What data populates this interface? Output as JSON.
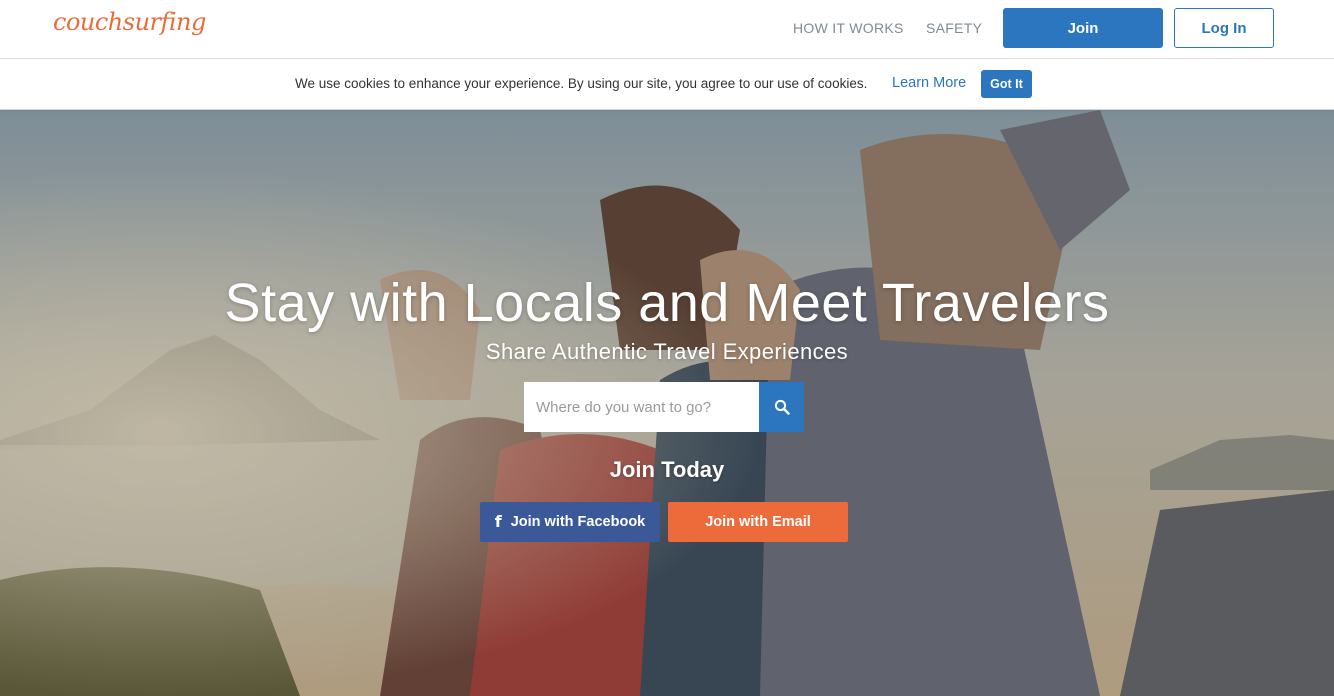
{
  "header": {
    "logo_text": "couchsurfing",
    "nav": {
      "how_it_works": "HOW IT WORKS",
      "safety": "SAFETY"
    },
    "join_label": "Join",
    "login_label": "Log In"
  },
  "cookie_banner": {
    "message": "We use cookies to enhance your experience. By using our site, you agree to our use of cookies.",
    "learn_more": "Learn More",
    "got_it": "Got It"
  },
  "hero": {
    "title": "Stay with Locals and Meet Travelers",
    "subtitle": "Share Authentic Travel Experiences",
    "search": {
      "placeholder": "Where do you want to go?",
      "icon": "search-icon"
    },
    "join_today": "Join Today",
    "facebook_button": {
      "icon_glyph": "f",
      "label": "Join with Facebook"
    },
    "email_button": {
      "label": "Join with Email"
    }
  },
  "colors": {
    "brand_orange": "#ed6b3a",
    "primary_blue": "#2c75bf",
    "facebook_blue": "#3b5998",
    "nav_gray": "#7f8a93"
  }
}
